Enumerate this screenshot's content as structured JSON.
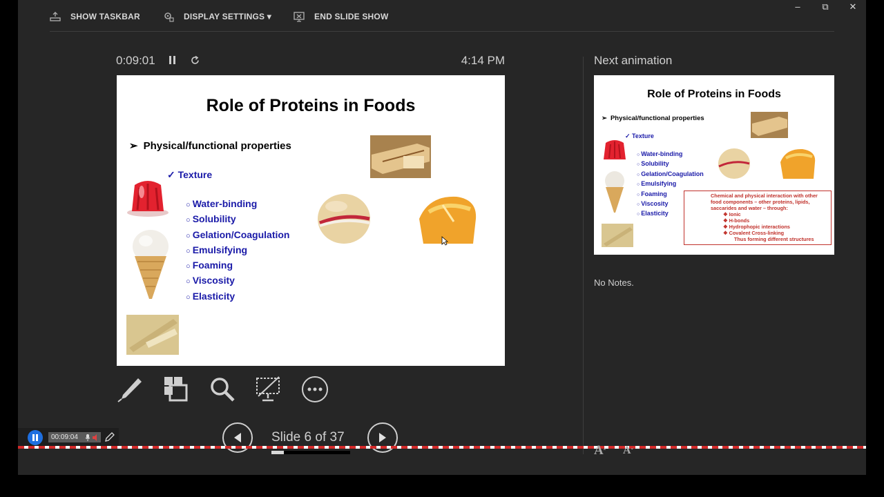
{
  "toolbar": {
    "show_taskbar": "SHOW TASKBAR",
    "display_settings": "DISPLAY SETTINGS ▾",
    "end_slide_show": "END SLIDE SHOW"
  },
  "window_controls": {
    "minimize": "–",
    "restore": "⧉",
    "close": "✕"
  },
  "presenter": {
    "elapsed": "0:09:01",
    "clock": "4:14 PM",
    "next_label": "Next animation",
    "notes": "No Notes.",
    "slide_counter": "Slide 6 of 37"
  },
  "slide": {
    "title": "Role of Proteins in Foods",
    "heading": "Physical/functional properties",
    "subheading": "Texture",
    "items": [
      "Water-binding",
      "Solubility",
      "Gelation/Coagulation",
      "Emulsifying",
      "Foaming",
      "Viscosity",
      "Elasticity"
    ]
  },
  "next_slide": {
    "title": "Role of Proteins in Foods",
    "heading": "Physical/functional properties",
    "subheading": "Texture",
    "items": [
      "Water-binding",
      "Solubility",
      "Gelation/Coagulation",
      "Emulsifying",
      "Foaming",
      "Viscosity",
      "Elasticity"
    ],
    "box_text": "Chemical and physical interaction with other food components – other proteins, lipids, saccarides and water – through:",
    "box_items": [
      "Ionic",
      "H-bonds",
      "Hydrophopic interactions",
      "Covalent Cross-linking"
    ],
    "box_footer": "Thus forming different structures"
  },
  "recorder": {
    "time": "00:09:04"
  },
  "colors": {
    "accent_blue": "#1a1aa8",
    "box_red": "#c0302a",
    "background": "#262626"
  }
}
